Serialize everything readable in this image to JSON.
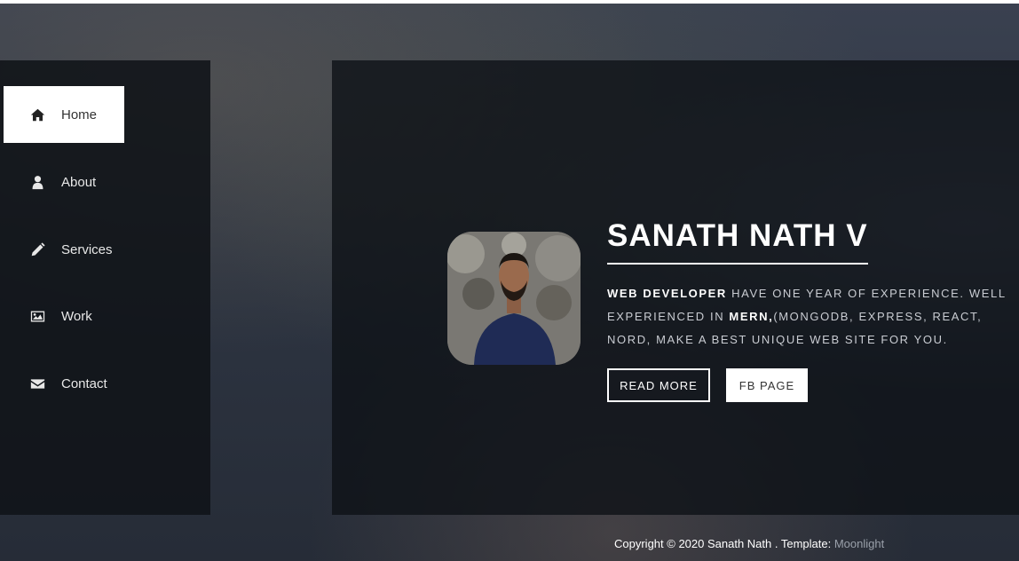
{
  "nav": {
    "items": [
      {
        "label": "Home",
        "icon": "home-icon",
        "active": true
      },
      {
        "label": "About",
        "icon": "user-icon",
        "active": false
      },
      {
        "label": "Services",
        "icon": "pencil-icon",
        "active": false
      },
      {
        "label": "Work",
        "icon": "image-icon",
        "active": false
      },
      {
        "label": "Contact",
        "icon": "envelope-icon",
        "active": false
      }
    ]
  },
  "hero": {
    "name": "SANATH NATH V",
    "desc_strong1": "WEB DEVELOPER",
    "desc_text1": " HAVE ONE YEAR OF EXPERIENCE. WELL EXPERIENCED IN ",
    "desc_strong2": "MERN,",
    "desc_text2": "(MONGODB, EXPRESS, REACT, NORD, MAKE A BEST UNIQUE WEB SITE FOR YOU.",
    "read_more": "READ MORE",
    "fb_page": "FB PAGE"
  },
  "footer": {
    "copyright": "Copyright © 2020 Sanath Nath . Template: ",
    "template_name": "Moonlight"
  },
  "colors": {
    "sidebar_bg": "#101318",
    "active_bg": "#ffffff",
    "text_light": "#e8e8e8",
    "link_muted": "#9aa0aa"
  }
}
